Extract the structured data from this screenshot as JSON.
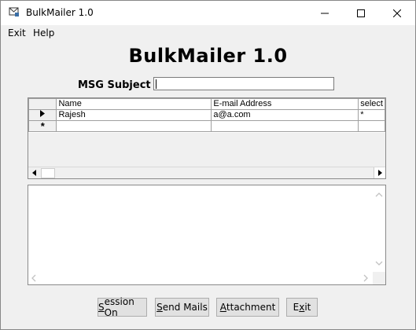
{
  "window": {
    "title": "BulkMailer 1.0"
  },
  "menu": {
    "items": [
      "Exit",
      "Help"
    ]
  },
  "heading": "BulkMailer 1.0",
  "subject": {
    "label": "MSG Subject",
    "value": ""
  },
  "grid": {
    "columns": [
      "Name",
      "E-mail Address",
      "select"
    ],
    "rows": [
      {
        "name": "Rajesh",
        "email": "a@a.com",
        "select": "*"
      }
    ],
    "new_row_marker": "*"
  },
  "memo": {
    "text": ""
  },
  "buttons": [
    {
      "accel": "S",
      "rest": "ession On"
    },
    {
      "accel": "S",
      "rest": "end Mails"
    },
    {
      "accel": "A",
      "rest": "ttachment"
    },
    {
      "prefix": "E",
      "accel": "x",
      "rest": "it"
    }
  ],
  "colors": {
    "window_bg": "#f0f0f0",
    "titlebar_bg": "#ffffff",
    "button_bg": "#e1e1e1"
  }
}
